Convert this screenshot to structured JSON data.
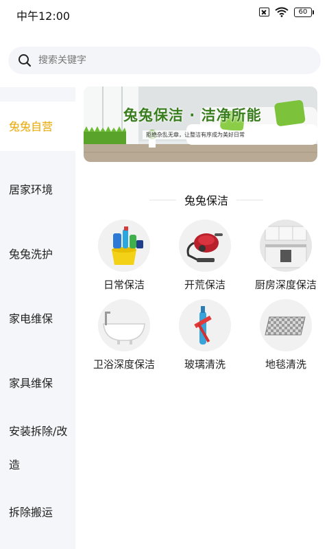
{
  "status_bar": {
    "time": "中午12:00",
    "battery": "60"
  },
  "search": {
    "placeholder": "搜索关键字"
  },
  "sidebar": {
    "items": [
      {
        "label": "兔兔自营",
        "active": true
      },
      {
        "label": "居家环境",
        "active": false
      },
      {
        "label": "兔兔洗护",
        "active": false
      },
      {
        "label": "家电维保",
        "active": false
      },
      {
        "label": "家具维保",
        "active": false
      },
      {
        "label": "安装拆除/改造",
        "active": false
      },
      {
        "label": "拆除搬运",
        "active": false
      }
    ]
  },
  "banner": {
    "title": "兔兔保洁 · 洁净所能",
    "subtitle": "拒绝杂乱无章，让整洁有序成为美好日常"
  },
  "section": {
    "title": "兔兔保洁"
  },
  "services": [
    {
      "label": "日常保洁",
      "icon": "cleaning-bucket-icon"
    },
    {
      "label": "开荒保洁",
      "icon": "vacuum-cleaner-icon"
    },
    {
      "label": "厨房深度保洁",
      "icon": "kitchen-icon"
    },
    {
      "label": "卫浴深度保洁",
      "icon": "bathtub-icon"
    },
    {
      "label": "玻璃清洗",
      "icon": "glass-wiper-icon"
    },
    {
      "label": "地毯清洗",
      "icon": "carpet-icon"
    }
  ],
  "colors": {
    "accent": "#e8a800",
    "sidebar_bg": "#f5f6f9",
    "search_bg": "#f4f5f8",
    "banner_text": "#3a7d1e"
  }
}
